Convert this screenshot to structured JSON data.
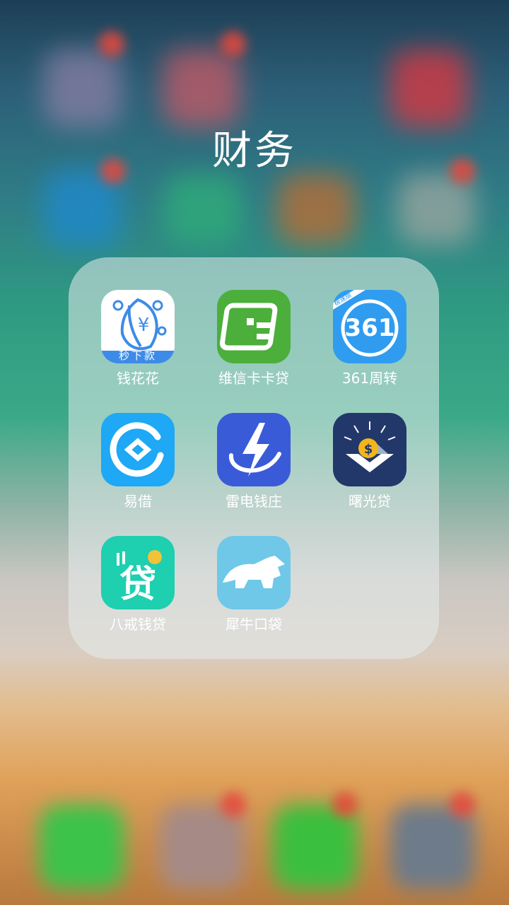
{
  "folder": {
    "title": "财务",
    "apps": [
      {
        "label": "钱花花",
        "badge_text": "秒下款",
        "icon": "leaf-yen-icon"
      },
      {
        "label": "维信卡卡贷",
        "icon": "card-icon"
      },
      {
        "label": "361周转",
        "icon_text": "361",
        "ribbon_text": "极速版",
        "icon": "ring-361-icon"
      },
      {
        "label": "易借",
        "icon": "letter-e-icon"
      },
      {
        "label": "雷电钱庄",
        "icon": "lightning-icon"
      },
      {
        "label": "曙光贷",
        "icon": "dollar-sunrise-icon"
      },
      {
        "label": "八戒钱贷",
        "icon_text": "贷",
        "icon": "loan-character-icon"
      },
      {
        "label": "犀牛口袋",
        "icon": "rhino-icon"
      }
    ]
  },
  "colors": {
    "qianhuahua_bg": "#ffffff",
    "qianhuahua_accent": "#3d8be8",
    "weixin_bg": "#4cae3b",
    "ring_bg": "#2f9cf0",
    "yijie_bg": "#1ea8f5",
    "leidian_bg": "#3a5bd8",
    "shuguang_bg": "#22386a",
    "bajie_bg": "#1ecfb0",
    "xiniu_bg": "#6fc8e8"
  }
}
